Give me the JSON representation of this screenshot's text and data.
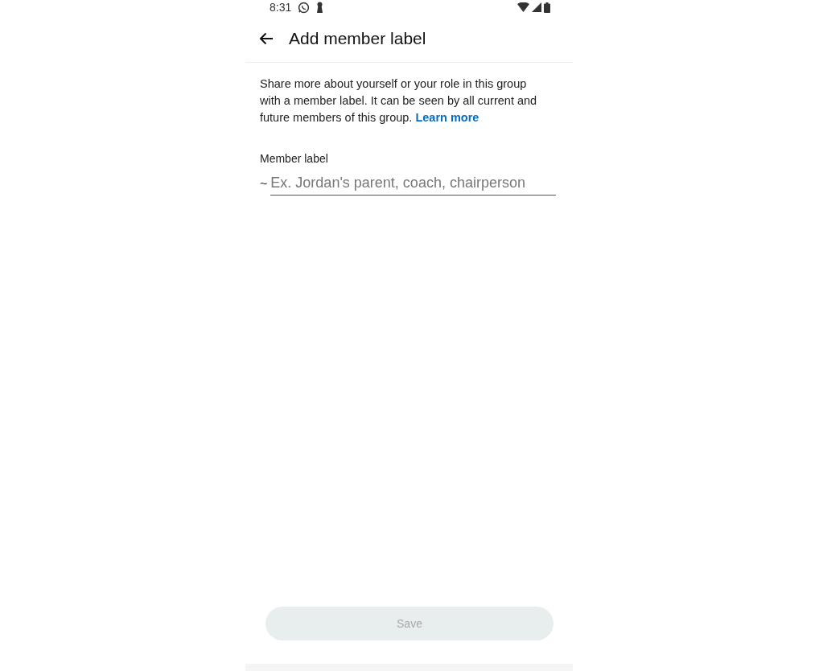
{
  "status_bar": {
    "time": "8:31"
  },
  "header": {
    "title": "Add member label"
  },
  "description": {
    "text": "Share more about yourself or your role in this group with a member label. It can be seen by all current and future members of this group.",
    "link": "Learn more"
  },
  "field": {
    "label": "Member label",
    "prefix": "~",
    "placeholder": "Ex. Jordan's parent, coach, chairperson"
  },
  "save_button": {
    "label": "Save",
    "disabled": true
  }
}
